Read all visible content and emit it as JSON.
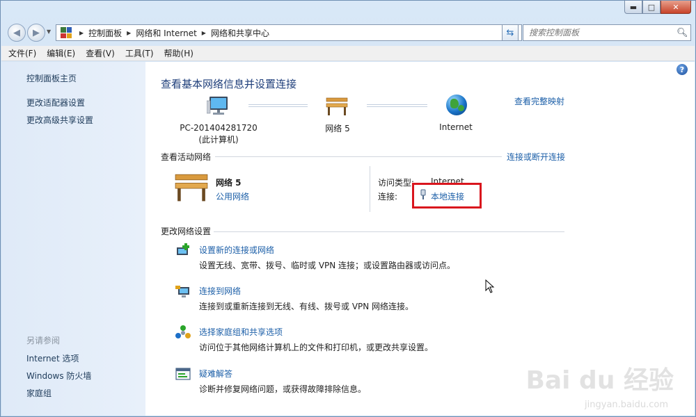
{
  "window": {
    "caption": {
      "minimize": "▬",
      "maximize": "□",
      "close": "✕"
    }
  },
  "address": {
    "crumbs": [
      "控制面板",
      "网络和 Internet",
      "网络和共享中心"
    ],
    "search_placeholder": "搜索控制面板"
  },
  "menu": [
    "文件(F)",
    "编辑(E)",
    "查看(V)",
    "工具(T)",
    "帮助(H)"
  ],
  "sidebar": {
    "links": [
      "控制面板主页",
      "更改适配器设置",
      "更改高级共享设置"
    ],
    "see_also_title": "另请参阅",
    "see_also": [
      "Internet 选项",
      "Windows 防火墙",
      "家庭组"
    ]
  },
  "main": {
    "title": "查看基本网络信息并设置连接",
    "view_full_map": "查看完整映射",
    "map": {
      "computer_name": "PC-201404281720",
      "computer_sub": "(此计算机)",
      "network": "网络  5",
      "internet": "Internet"
    },
    "active_networks": {
      "title": "查看活动网络",
      "connect_disconnect": "连接或断开连接",
      "network_name": "网络  5",
      "network_type": "公用网络",
      "access_type_label": "访问类型:",
      "access_type_value": "Internet",
      "connections_label": "连接:",
      "connection_value": "本地连接"
    },
    "change_settings": {
      "title": "更改网络设置",
      "tasks": [
        {
          "title": "设置新的连接或网络",
          "desc": "设置无线、宽带、拨号、临时或 VPN 连接；或设置路由器或访问点。"
        },
        {
          "title": "连接到网络",
          "desc": "连接到或重新连接到无线、有线、拨号或 VPN 网络连接。"
        },
        {
          "title": "选择家庭组和共享选项",
          "desc": "访问位于其他网络计算机上的文件和打印机，或更改共享设置。"
        },
        {
          "title": "疑难解答",
          "desc": "诊断并修复网络问题，或获得故障排除信息。"
        }
      ]
    }
  },
  "watermark": {
    "brand": "Bai du 经验",
    "url": "jingyan.baidu.com"
  },
  "colors": {
    "link": "#1c5fa8",
    "heading": "#1e3e7a",
    "highlight_box": "#d9151d"
  }
}
